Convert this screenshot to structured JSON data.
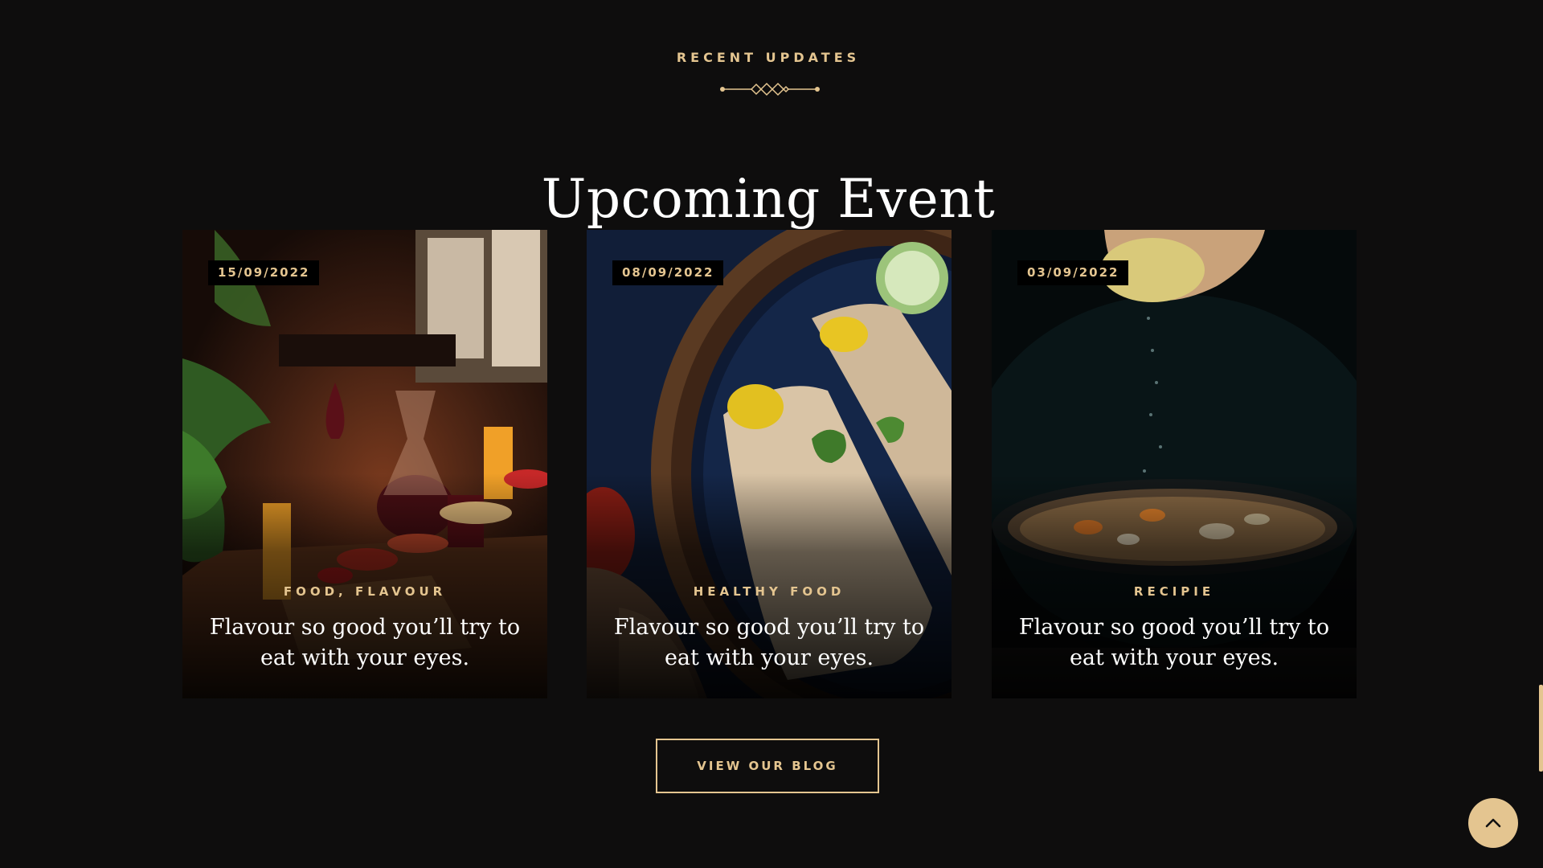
{
  "section": {
    "subtitle": "RECENT UPDATES",
    "title": "Upcoming Event"
  },
  "cards": [
    {
      "date": "15/09/2022",
      "tag": "FOOD, FLAVOUR",
      "heading": "Flavour so good you’ll try to eat with your eyes.",
      "image": "restaurant-table-photo"
    },
    {
      "date": "08/09/2022",
      "tag": "HEALTHY FOOD",
      "heading": "Flavour so good you’ll try to eat with your eyes.",
      "image": "dosa-plate-photo"
    },
    {
      "date": "03/09/2022",
      "tag": "RECIPIE",
      "heading": "Flavour so good you’ll try to eat with your eyes.",
      "image": "soup-bowl-photo"
    }
  ],
  "blog_button": {
    "label": "VIEW OUR BLOG"
  },
  "back_to_top": {
    "icon": "chevron-up-icon"
  },
  "colors": {
    "background": "#0e0d0d",
    "accent": "#e4c590",
    "text": "#ffffff"
  }
}
